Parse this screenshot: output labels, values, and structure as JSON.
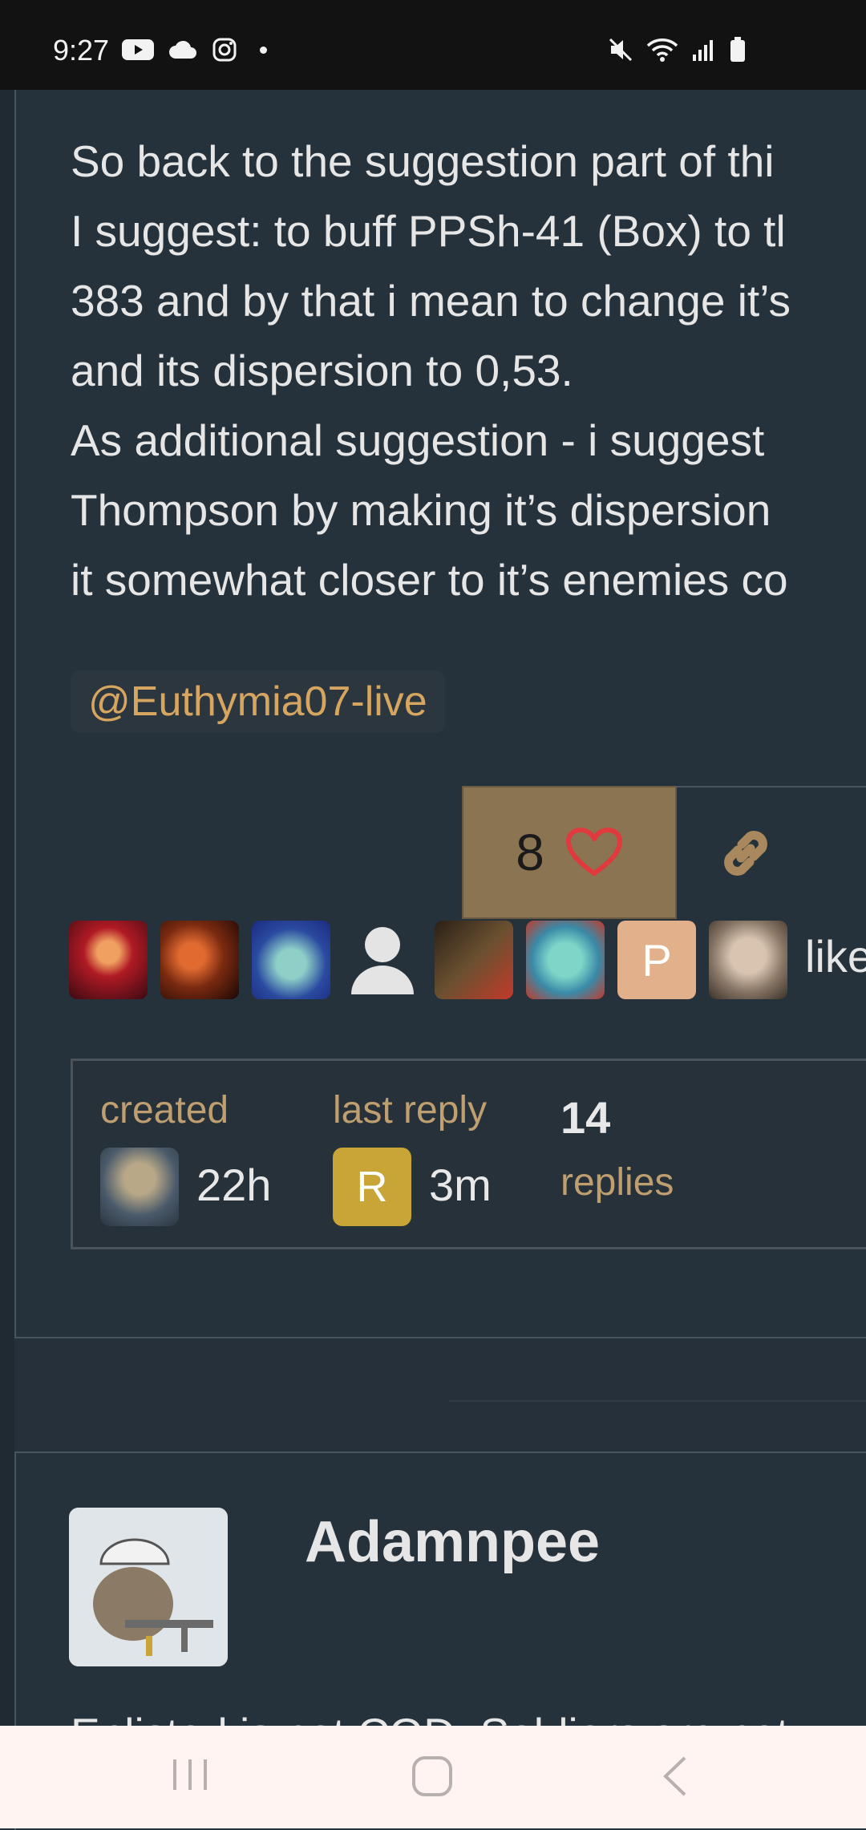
{
  "status_bar": {
    "time": "9:27",
    "left_icons": [
      "youtube-icon",
      "cloud-icon",
      "instagram-icon",
      "notification-dot"
    ],
    "right_icons": [
      "mute-icon",
      "wifi-icon",
      "signal-icon",
      "battery-icon"
    ]
  },
  "post": {
    "lines": [
      "So back to the suggestion part of thi",
      "I suggest: to buff PPSh-41 (Box) to tl",
      "383 and by that i mean to change it’s",
      "and its dispersion to 0,53.",
      "As additional suggestion - i suggest",
      "Thompson by making it’s dispersion",
      "it somewhat closer to it’s enemies co"
    ],
    "mention": "@Euthymia07-live",
    "like_count": "8",
    "likers_label": "like",
    "liker_initial": "P"
  },
  "topic_map": {
    "created_label": "created",
    "created_value": "22h",
    "last_reply_label": "last reply",
    "last_reply_initial": "R",
    "last_reply_value": "3m",
    "replies_count": "14",
    "replies_label": "replies"
  },
  "next_post": {
    "author": "Adamnpee",
    "snippet": "Enlisted is not COD. Soldiers are not"
  },
  "colors": {
    "accent": "#d6a560",
    "like_button": "#8b7452",
    "heart": "#e0393e",
    "background": "#25303a"
  }
}
